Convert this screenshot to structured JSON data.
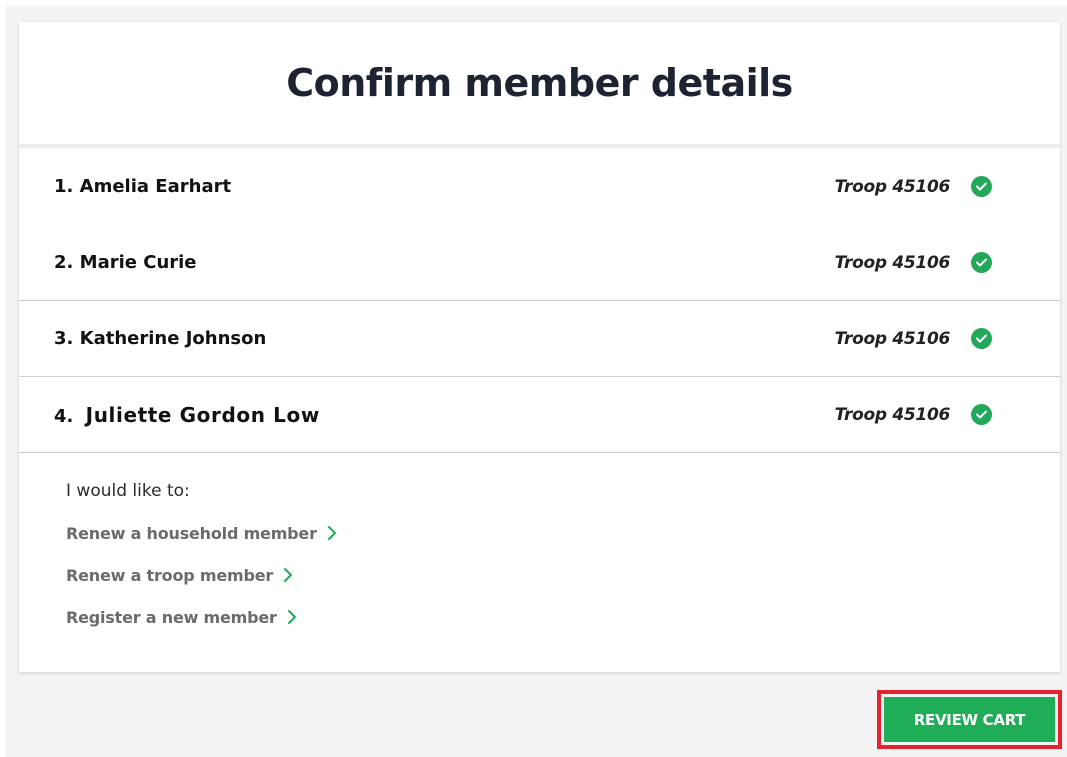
{
  "page": {
    "title": "Confirm member details"
  },
  "members": [
    {
      "number": "1.",
      "name": "Amelia Earhart",
      "troop": "Troop 45106",
      "status_icon": "check-circle-icon"
    },
    {
      "number": "2.",
      "name": "Marie Curie",
      "troop": "Troop 45106",
      "status_icon": "check-circle-icon"
    },
    {
      "number": "3.",
      "name": "Katherine Johnson",
      "troop": "Troop 45106",
      "status_icon": "check-circle-icon"
    },
    {
      "number": "4.",
      "name": "Juliette Gordon Low",
      "troop": "Troop 45106",
      "status_icon": "check-circle-icon"
    }
  ],
  "options": {
    "label": "I would like to:",
    "links": [
      {
        "label": "Renew a household member",
        "icon": "chevron-right-icon"
      },
      {
        "label": "Renew a troop member",
        "icon": "chevron-right-icon"
      },
      {
        "label": "Register a new member",
        "icon": "chevron-right-icon"
      }
    ]
  },
  "actions": {
    "review_cart_label": "REVIEW CART"
  },
  "colors": {
    "accent_green": "#22a85a",
    "button_green": "#1fad58",
    "highlight_red": "#e8222c",
    "title_text": "#1d2330"
  }
}
